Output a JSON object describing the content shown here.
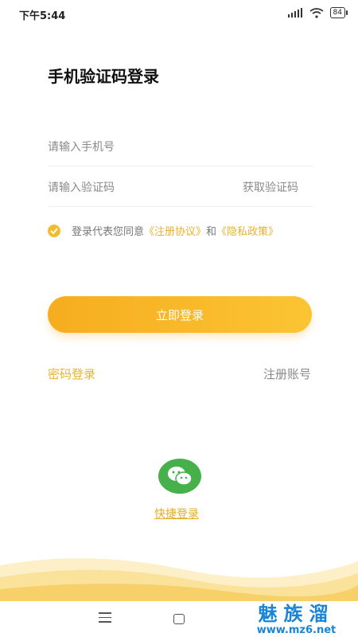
{
  "status_bar": {
    "time": "下午5:44",
    "battery": "84"
  },
  "login": {
    "title": "手机验证码登录",
    "phone_placeholder": "请输入手机号",
    "code_placeholder": "请输入验证码",
    "get_code_label": "获取验证码",
    "agreement_prefix": "登录代表您同意",
    "agreement_link1": "《注册协议》",
    "agreement_and": "和",
    "agreement_link2": "《隐私政策》",
    "agreement_checked": true,
    "submit_label": "立即登录",
    "password_login_label": "密码登录",
    "register_label": "注册账号",
    "quick_login_label": "快捷登录"
  },
  "watermark": {
    "text": "魅族溜",
    "url": "www.mz6.net"
  },
  "colors": {
    "accent": "#f6b024",
    "link": "#e8b22c",
    "wechat": "#46b14a"
  },
  "icons": [
    "signal-icon",
    "wifi-icon",
    "battery-icon",
    "check-icon",
    "wechat-icon",
    "menu-icon",
    "home-icon"
  ]
}
